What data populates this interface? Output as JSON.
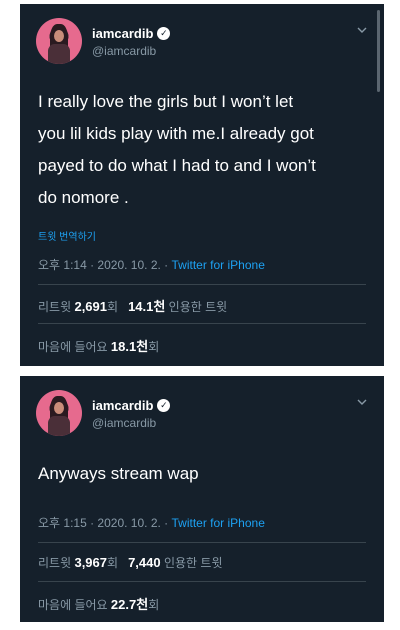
{
  "tweets": [
    {
      "user": {
        "display_name": "iamcardib",
        "handle": "@iamcardib"
      },
      "text_lines": [
        "I really love the girls but I won’t let",
        "you lil kids play with me.I already got",
        "payed to do what I had to and I won’t",
        "do nomore ."
      ],
      "translate_label": "트윗 번역하기",
      "timestamp": "오후 1:14 · 2020. 10. 2. · ",
      "source": "Twitter for iPhone",
      "retweets_label": "리트윗 ",
      "retweets_count": "2,691",
      "retweets_suffix": "회",
      "quotes_count": "14.1천",
      "quotes_label": " 인용한 트윗",
      "likes_label": "마음에 들어요 ",
      "likes_count": "18.1천",
      "likes_suffix": "회"
    },
    {
      "user": {
        "display_name": "iamcardib",
        "handle": "@iamcardib"
      },
      "text": "Anyways stream wap",
      "timestamp": "오후 1:15 · 2020. 10. 2. · ",
      "source": "Twitter for iPhone",
      "retweets_label": "리트윗 ",
      "retweets_count": "3,967",
      "retweets_suffix": "회",
      "quotes_count": "7,440",
      "quotes_label": " 인용한 트윗",
      "likes_label": "마음에 들어요 ",
      "likes_count": "22.7천",
      "likes_suffix": "회"
    }
  ],
  "colors": {
    "background": "#15202b",
    "text": "#ffffff",
    "secondary_text": "#8899a6",
    "link": "#1da1f2",
    "divider": "#38444d"
  },
  "icons": [
    "verified-badge-icon",
    "chevron-down-icon"
  ]
}
